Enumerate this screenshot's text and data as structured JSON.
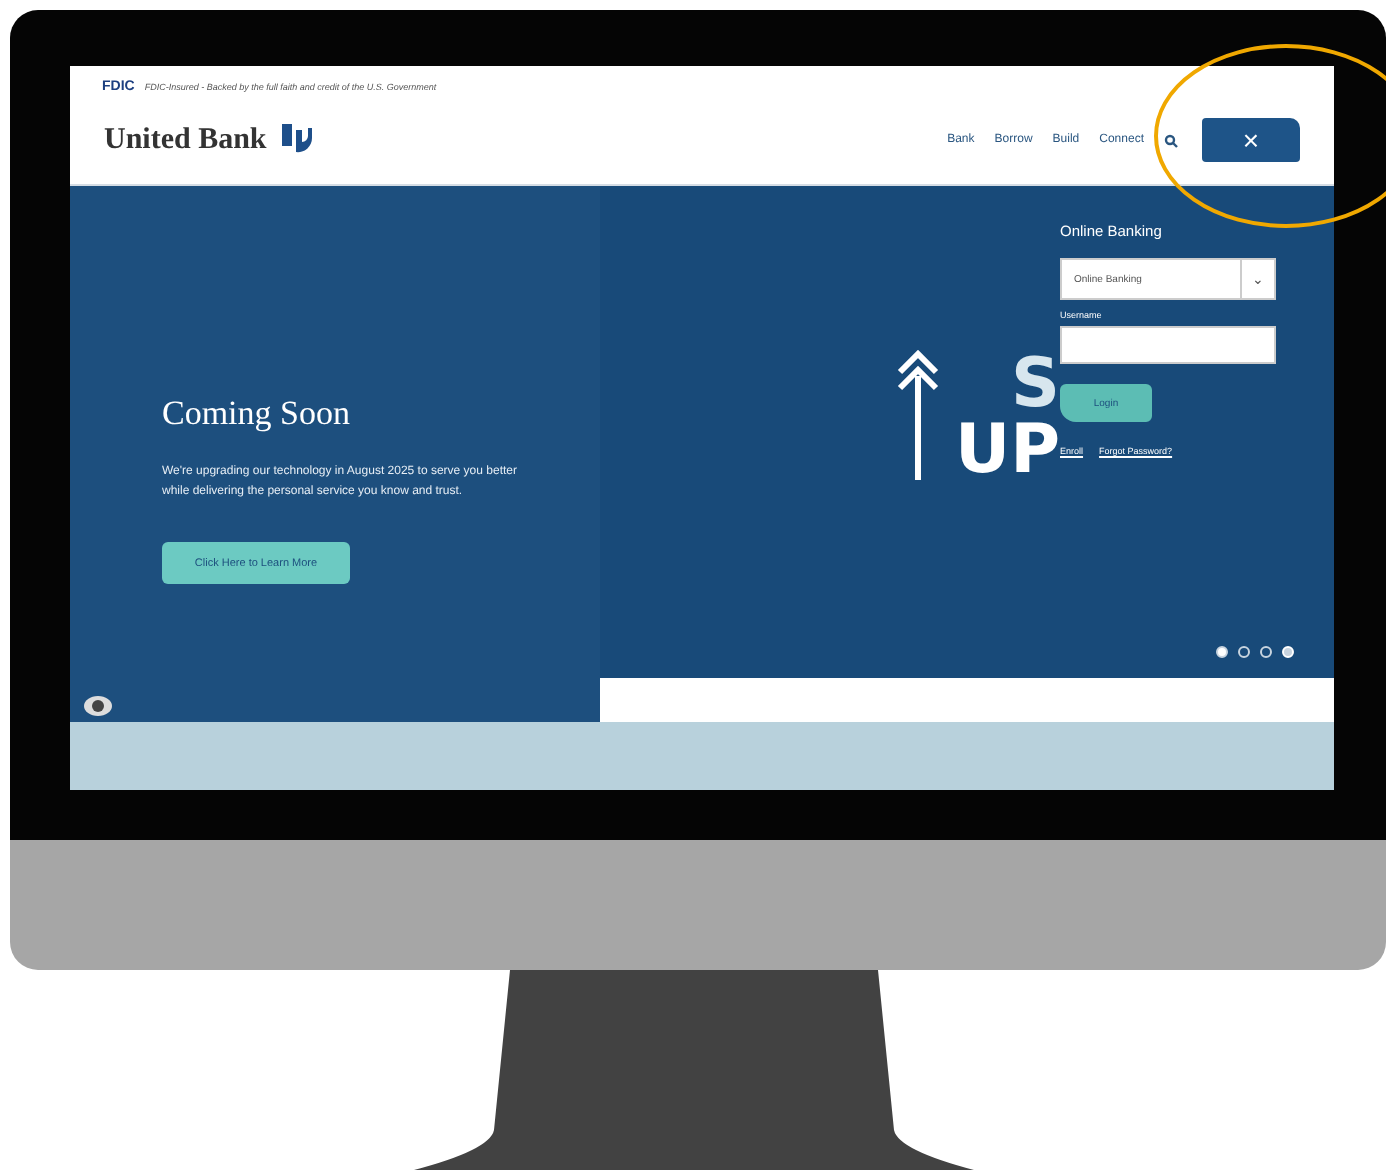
{
  "notice": {
    "badge": "FDIC",
    "text": "FDIC-Insured - Backed by the full faith and credit of the U.S. Government"
  },
  "brand": {
    "name": "United Bank"
  },
  "nav": [
    {
      "label": "Bank"
    },
    {
      "label": "Borrow"
    },
    {
      "label": "Build"
    },
    {
      "label": "Connect"
    }
  ],
  "close_button": {
    "label": "×",
    "highlighted": true
  },
  "hero": {
    "title": "Coming Soon",
    "body": "We're upgrading our technology in August 2025 to serve you better while delivering the personal service you know and trust.",
    "button": "Click Here to Learn More",
    "graphic_text": [
      "S",
      "UP"
    ]
  },
  "login": {
    "title": "Online Banking",
    "select": "Online Banking",
    "select_caret": "⌄",
    "username_label": "Username",
    "button": "Login",
    "links": [
      "Enroll",
      "Forgot Password?"
    ]
  },
  "carousel": [
    {
      "kind": "dot",
      "selected": true
    },
    {
      "kind": "dot",
      "selected": false
    },
    {
      "kind": "dot",
      "selected": false
    },
    {
      "kind": "pause",
      "selected": false
    }
  ]
}
